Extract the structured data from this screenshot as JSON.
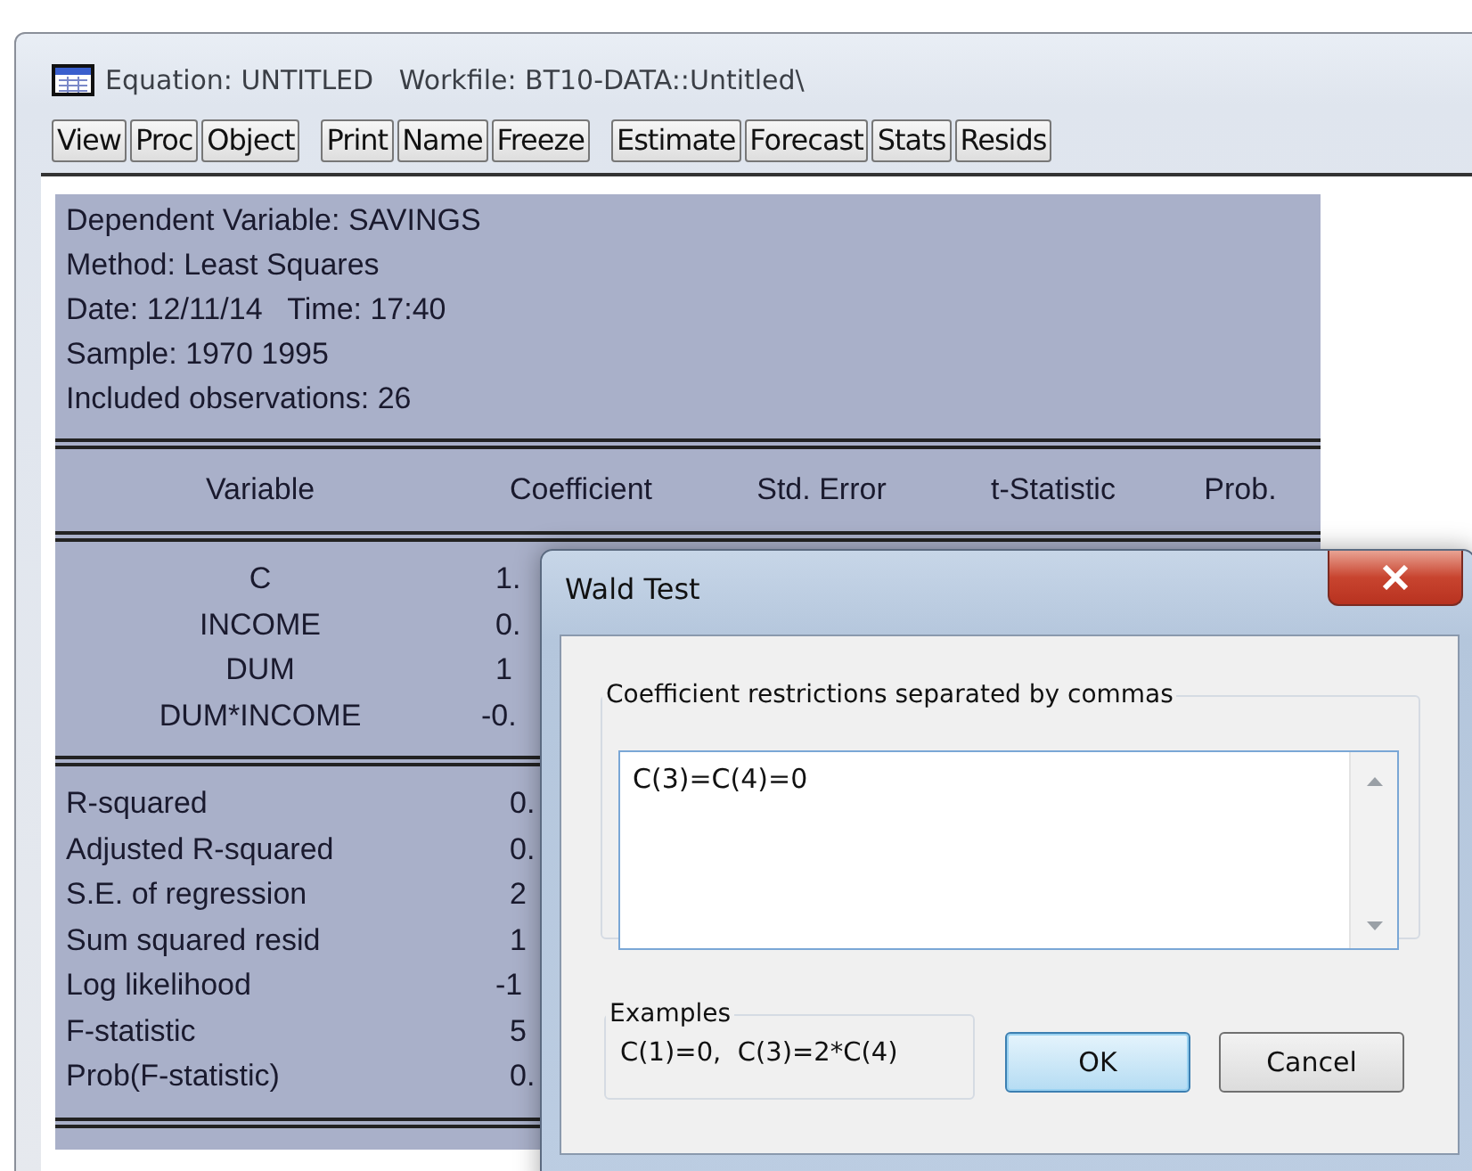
{
  "window": {
    "title": "Equation: UNTITLED   Workfile: BT10-DATA::Untitled\\"
  },
  "toolbar": [
    [
      "View",
      "Proc",
      "Object"
    ],
    [
      "Print",
      "Name",
      "Freeze"
    ],
    [
      "Estimate",
      "Forecast",
      "Stats",
      "Resids"
    ]
  ],
  "output": {
    "header_lines": [
      "Dependent Variable: SAVINGS",
      "Method: Least Squares",
      "Date: 12/11/14   Time: 17:40",
      "Sample: 1970 1995",
      "Included observations: 26"
    ],
    "columns": [
      "Variable",
      "Coefficient",
      "Std. Error",
      "t-Statistic",
      "Prob."
    ],
    "rows": [
      {
        "variable": "C",
        "coefficient": "1."
      },
      {
        "variable": "INCOME",
        "coefficient": "0."
      },
      {
        "variable": "DUM",
        "coefficient": "1"
      },
      {
        "variable": "DUM*INCOME",
        "coefficient": "-0."
      }
    ],
    "stats": [
      {
        "label": "R-squared",
        "value": "0."
      },
      {
        "label": "Adjusted R-squared",
        "value": "0."
      },
      {
        "label": "S.E. of regression",
        "value": "2"
      },
      {
        "label": "Sum squared resid",
        "value": "1"
      },
      {
        "label": "Log likelihood",
        "value": "-1"
      },
      {
        "label": "F-statistic",
        "value": "5"
      },
      {
        "label": "Prob(F-statistic)",
        "value": "0."
      }
    ]
  },
  "dialog": {
    "title": "Wald Test",
    "restrictions": {
      "label": "Coefficient restrictions separated by commas",
      "value": "C(3)=C(4)=0"
    },
    "examples": {
      "label": "Examples",
      "text": "C(1)=0,  C(3)=2*C(4)"
    },
    "buttons": [
      {
        "label": "OK",
        "default": true
      },
      {
        "label": "Cancel",
        "default": false
      }
    ]
  }
}
